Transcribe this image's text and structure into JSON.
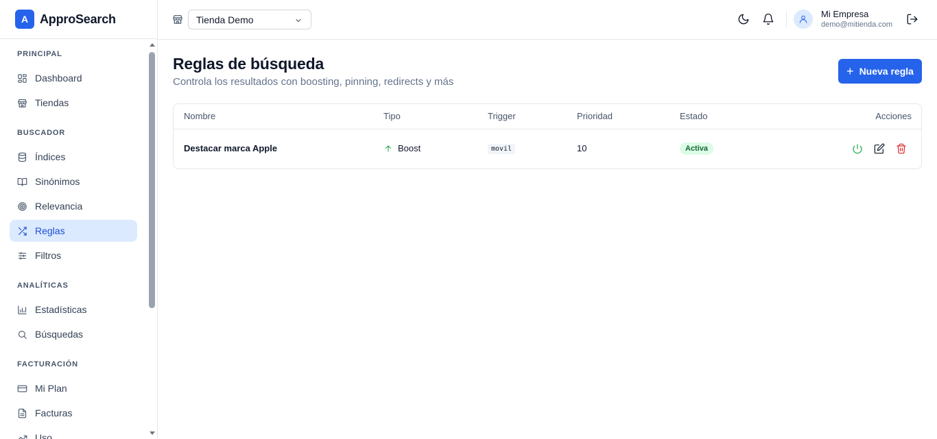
{
  "app": {
    "logo_letter": "A",
    "name": "ApproSearch"
  },
  "sidebar": {
    "sections": [
      {
        "title": "PRINCIPAL",
        "items": [
          {
            "label": "Dashboard",
            "icon": "dashboard-icon"
          },
          {
            "label": "Tiendas",
            "icon": "store-icon"
          }
        ]
      },
      {
        "title": "BUSCADOR",
        "items": [
          {
            "label": "Índices",
            "icon": "database-icon"
          },
          {
            "label": "Sinónimos",
            "icon": "book-open-icon"
          },
          {
            "label": "Relevancia",
            "icon": "target-icon"
          },
          {
            "label": "Reglas",
            "icon": "shuffle-icon",
            "active": true
          },
          {
            "label": "Filtros",
            "icon": "sliders-icon"
          }
        ]
      },
      {
        "title": "ANALÍTICAS",
        "items": [
          {
            "label": "Estadísticas",
            "icon": "bar-chart-icon"
          },
          {
            "label": "Búsquedas",
            "icon": "search-icon"
          }
        ]
      },
      {
        "title": "FACTURACIÓN",
        "items": [
          {
            "label": "Mi Plan",
            "icon": "credit-card-icon"
          },
          {
            "label": "Facturas",
            "icon": "file-text-icon"
          },
          {
            "label": "Uso",
            "icon": "trending-up-icon"
          }
        ]
      }
    ]
  },
  "header": {
    "store_select": "Tienda Demo",
    "user": {
      "name": "Mi Empresa",
      "email": "demo@mitienda.com"
    }
  },
  "main": {
    "title": "Reglas de búsqueda",
    "subtitle": "Controla los resultados con boosting, pinning, redirects y más",
    "new_button": "Nueva regla",
    "table": {
      "columns": [
        "Nombre",
        "Tipo",
        "Trigger",
        "Prioridad",
        "Estado",
        "Acciones"
      ],
      "rows": [
        {
          "name": "Destacar marca Apple",
          "type": "Boost",
          "trigger": "movil",
          "priority": "10",
          "status": "Activa"
        }
      ]
    }
  },
  "colors": {
    "accent": "#2563eb",
    "active_bg": "#dbeafe",
    "success": "#16a34a",
    "danger": "#dc2626"
  }
}
